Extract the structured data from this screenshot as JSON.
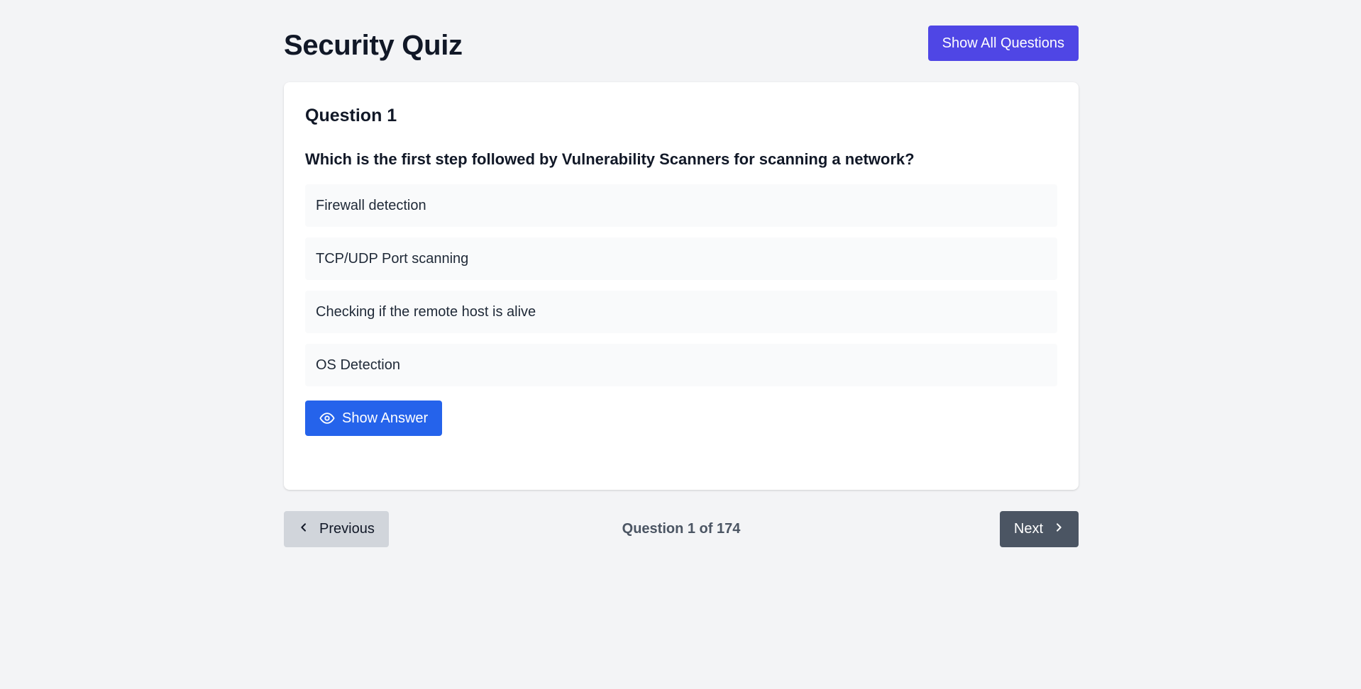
{
  "header": {
    "title": "Security Quiz",
    "show_all_label": "Show All Questions"
  },
  "question": {
    "number_label": "Question 1",
    "text": "Which is the first step followed by Vulnerability Scanners for scanning a network?",
    "options": [
      "Firewall detection",
      "TCP/UDP Port scanning",
      "Checking if the remote host is alive",
      "OS Detection"
    ],
    "show_answer_label": "Show Answer",
    "show_answer_icon": "eye-icon"
  },
  "navigation": {
    "previous_label": "Previous",
    "previous_icon": "chevron-left-icon",
    "next_label": "Next",
    "next_icon": "chevron-right-icon",
    "progress": "Question 1 of 174",
    "current": 1,
    "total": 174
  },
  "colors": {
    "background": "#f3f4f6",
    "show_all_button": "#4f46e5",
    "show_answer_button": "#2563eb",
    "previous_button": "#d1d5db",
    "next_button": "#4b5563"
  }
}
